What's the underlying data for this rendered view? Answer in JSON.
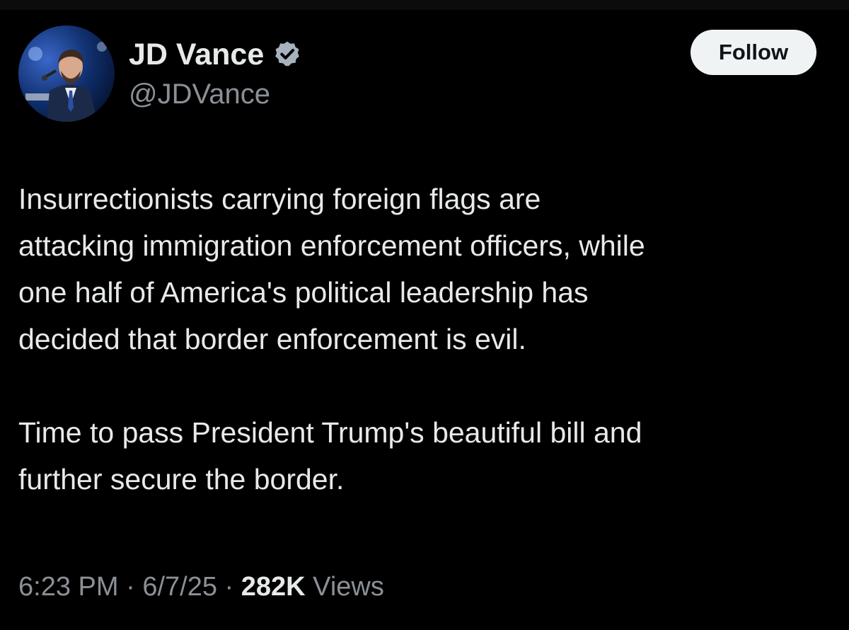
{
  "author": {
    "display_name": "JD Vance",
    "handle": "@JDVance",
    "verified": true,
    "avatar_icon": "profile-photo"
  },
  "follow_button": {
    "label": "Follow"
  },
  "tweet": {
    "paragraphs": [
      "Insurrectionists carrying foreign flags are\nattacking immigration enforcement officers, while\none half of America's political leadership has\ndecided that border enforcement is evil.",
      "Time to pass President Trump's beautiful bill and\nfurther secure the border."
    ]
  },
  "meta": {
    "time": "6:23 PM",
    "separator": "·",
    "date": "6/7/25",
    "views_count": "282K",
    "views_label": "Views"
  },
  "colors": {
    "background": "#000000",
    "text_primary": "#e7e9ea",
    "text_secondary": "#8b9096",
    "follow_button_bg": "#eff3f4",
    "verified_badge": "#a8b2bd"
  }
}
